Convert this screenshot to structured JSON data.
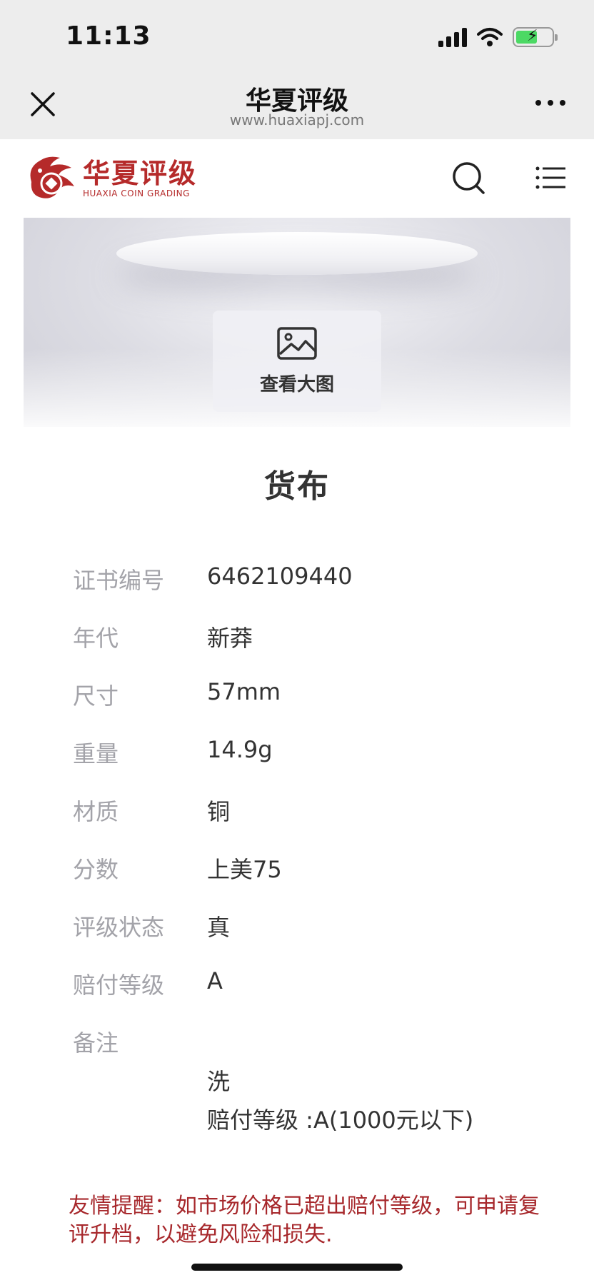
{
  "status_bar": {
    "time": "11:13"
  },
  "nav": {
    "title": "华夏评级",
    "url": "www.huaxiapj.com"
  },
  "site": {
    "logo_cn": "华夏评级",
    "logo_en": "HUAXIA COIN GRADING"
  },
  "hero": {
    "view_label": "查看大图"
  },
  "page_title": "货布",
  "details": [
    {
      "key": "证书编号",
      "value": "6462109440"
    },
    {
      "key": "年代",
      "value": "新莽"
    },
    {
      "key": "尺寸",
      "value": "57mm"
    },
    {
      "key": "重量",
      "value": "14.9g"
    },
    {
      "key": "材质",
      "value": "铜"
    },
    {
      "key": "分数",
      "value": "上美75"
    },
    {
      "key": "评级状态",
      "value": "真"
    },
    {
      "key": "赔付等级",
      "value": "A"
    }
  ],
  "remark": {
    "key": "备注",
    "line1": "洗",
    "line2": "赔付等级 :A(1000元以下)"
  },
  "reminder": "友情提醒：如市场价格已超出赔付等级，可申请复评升档，以避免风险和损失.",
  "colors": {
    "brand": "#b52a2a",
    "reminder": "#a7282c",
    "label": "#a3a3a9",
    "value": "#333333"
  }
}
